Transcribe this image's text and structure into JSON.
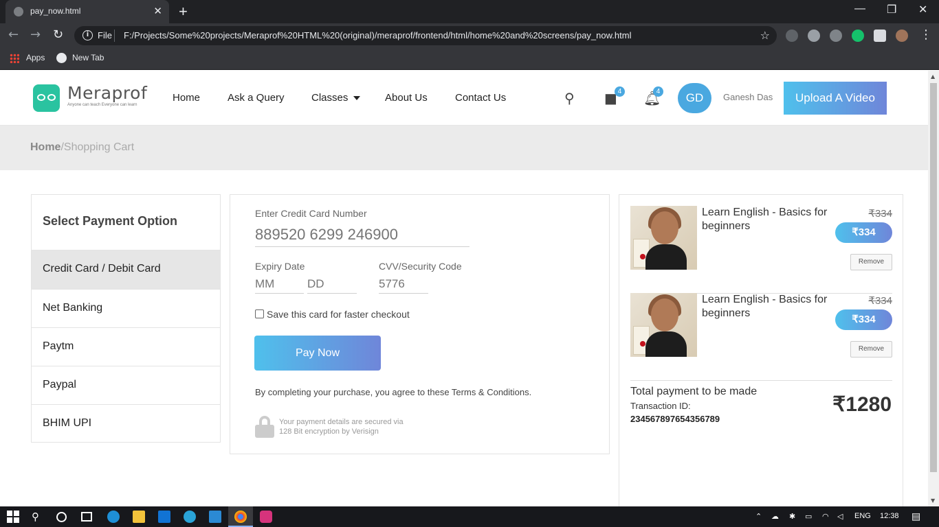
{
  "browser": {
    "tab_title": "pay_now.html",
    "scheme": "File",
    "url": "F:/Projects/Some%20projects/Meraprof%20HTML%20(original)/meraprof/frontend/html/home%20and%20screens/pay_now.html",
    "bookmarks": [
      "Apps",
      "New Tab"
    ]
  },
  "header": {
    "logo_name": "Meraprof",
    "logo_tagline": "Anyone can teach Everyone can learn",
    "nav": [
      "Home",
      "Ask a Query",
      "Classes",
      "About Us",
      "Contact Us"
    ],
    "cart_count": "4",
    "notif_count": "4",
    "avatar_initials": "GD",
    "user_name": "Ganesh Das",
    "upload_label": "Upload A Video"
  },
  "breadcrumb": {
    "home": "Home",
    "separator": "/",
    "current": "Shopping Cart"
  },
  "payment_options": {
    "title": "Select Payment Option",
    "items": [
      "Credit Card / Debit Card",
      "Net Banking",
      "Paytm",
      "Paypal",
      "BHIM UPI"
    ],
    "active_index": 0
  },
  "card_form": {
    "card_label": "Enter Credit Card Number",
    "card_placeholder": "889520 6299 246900",
    "expiry_label": "Expiry Date",
    "month_placeholder": "MM",
    "day_placeholder": "DD",
    "cvv_label": "CVV/Security Code",
    "cvv_placeholder": "5776",
    "save_label": "Save this card for faster checkout",
    "pay_label": "Pay Now",
    "terms": "By completing your purchase, you agree to these Terms & Conditions.",
    "secure_line1": "Your payment details are secured via",
    "secure_line2": "128 Bit encryption by Verisign"
  },
  "cart": {
    "items": [
      {
        "title": "Learn English - Basics for beginners",
        "old_price": "₹334",
        "price": "₹334",
        "remove_label": "Remove"
      },
      {
        "title": "Learn English - Basics for beginners",
        "old_price": "₹334",
        "price": "₹334",
        "remove_label": "Remove"
      }
    ],
    "total_label": "Total payment to be made",
    "transaction_label": "Transaction ID:",
    "transaction_id": "234567897654356789",
    "total_amount": "₹1280"
  },
  "taskbar": {
    "language": "ENG",
    "time": "12:38"
  },
  "colors": {
    "accent_gradient_start": "#4fc0ec",
    "accent_gradient_end": "#6f86d9",
    "logo_green": "#2ac3a0",
    "badge_blue": "#4aa8e0"
  }
}
